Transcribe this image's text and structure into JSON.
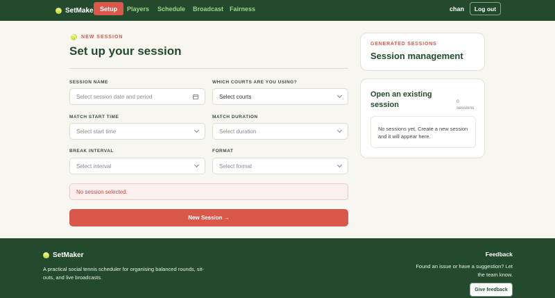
{
  "nav": {
    "brand": "SetMaker",
    "tabs": [
      {
        "label": "Setup",
        "active": true
      },
      {
        "label": "Players",
        "active": false
      },
      {
        "label": "Schedule",
        "active": false
      },
      {
        "label": "Broadcast",
        "active": false
      },
      {
        "label": "Fairness",
        "active": false
      }
    ],
    "user": "chan",
    "logout": "Log out"
  },
  "form": {
    "eyebrow": "NEW SESSION",
    "title": "Set up your session",
    "session_name": {
      "label": "SESSION NAME",
      "placeholder": "Select session date and period"
    },
    "courts": {
      "label": "WHICH COURTS ARE YOU USING?",
      "value": "Select courts"
    },
    "start_time": {
      "label": "MATCH START TIME",
      "placeholder": "Select start time"
    },
    "duration": {
      "label": "MATCH DURATION",
      "placeholder": "Select duration"
    },
    "break_interval": {
      "label": "BREAK INTERVAL",
      "placeholder": "Select interval"
    },
    "format": {
      "label": "FORMAT",
      "placeholder": "Select format"
    },
    "error": "No session selected.",
    "submit": "New Session →"
  },
  "panel": {
    "eyebrow": "GENERATED SESSIONS",
    "title": "Session management",
    "open_title": "Open an existing session",
    "count": "0",
    "count_unit": "sessions",
    "empty": "No sessions yet. Create a new session and it will appear here."
  },
  "footer": {
    "brand": "SetMaker",
    "description": "A practical social tennis scheduler for organising balanced rounds, sit-outs, and live broadcasts.",
    "feedback_title": "Feedback",
    "feedback_text": "Found an issue or have a suggestion? Let the team know.",
    "feedback_button": "Give feedback"
  },
  "colors": {
    "primary_green": "#244a2e",
    "accent_red": "#d9584a",
    "nav_link": "#9ed48a",
    "background": "#f8f6f0"
  }
}
